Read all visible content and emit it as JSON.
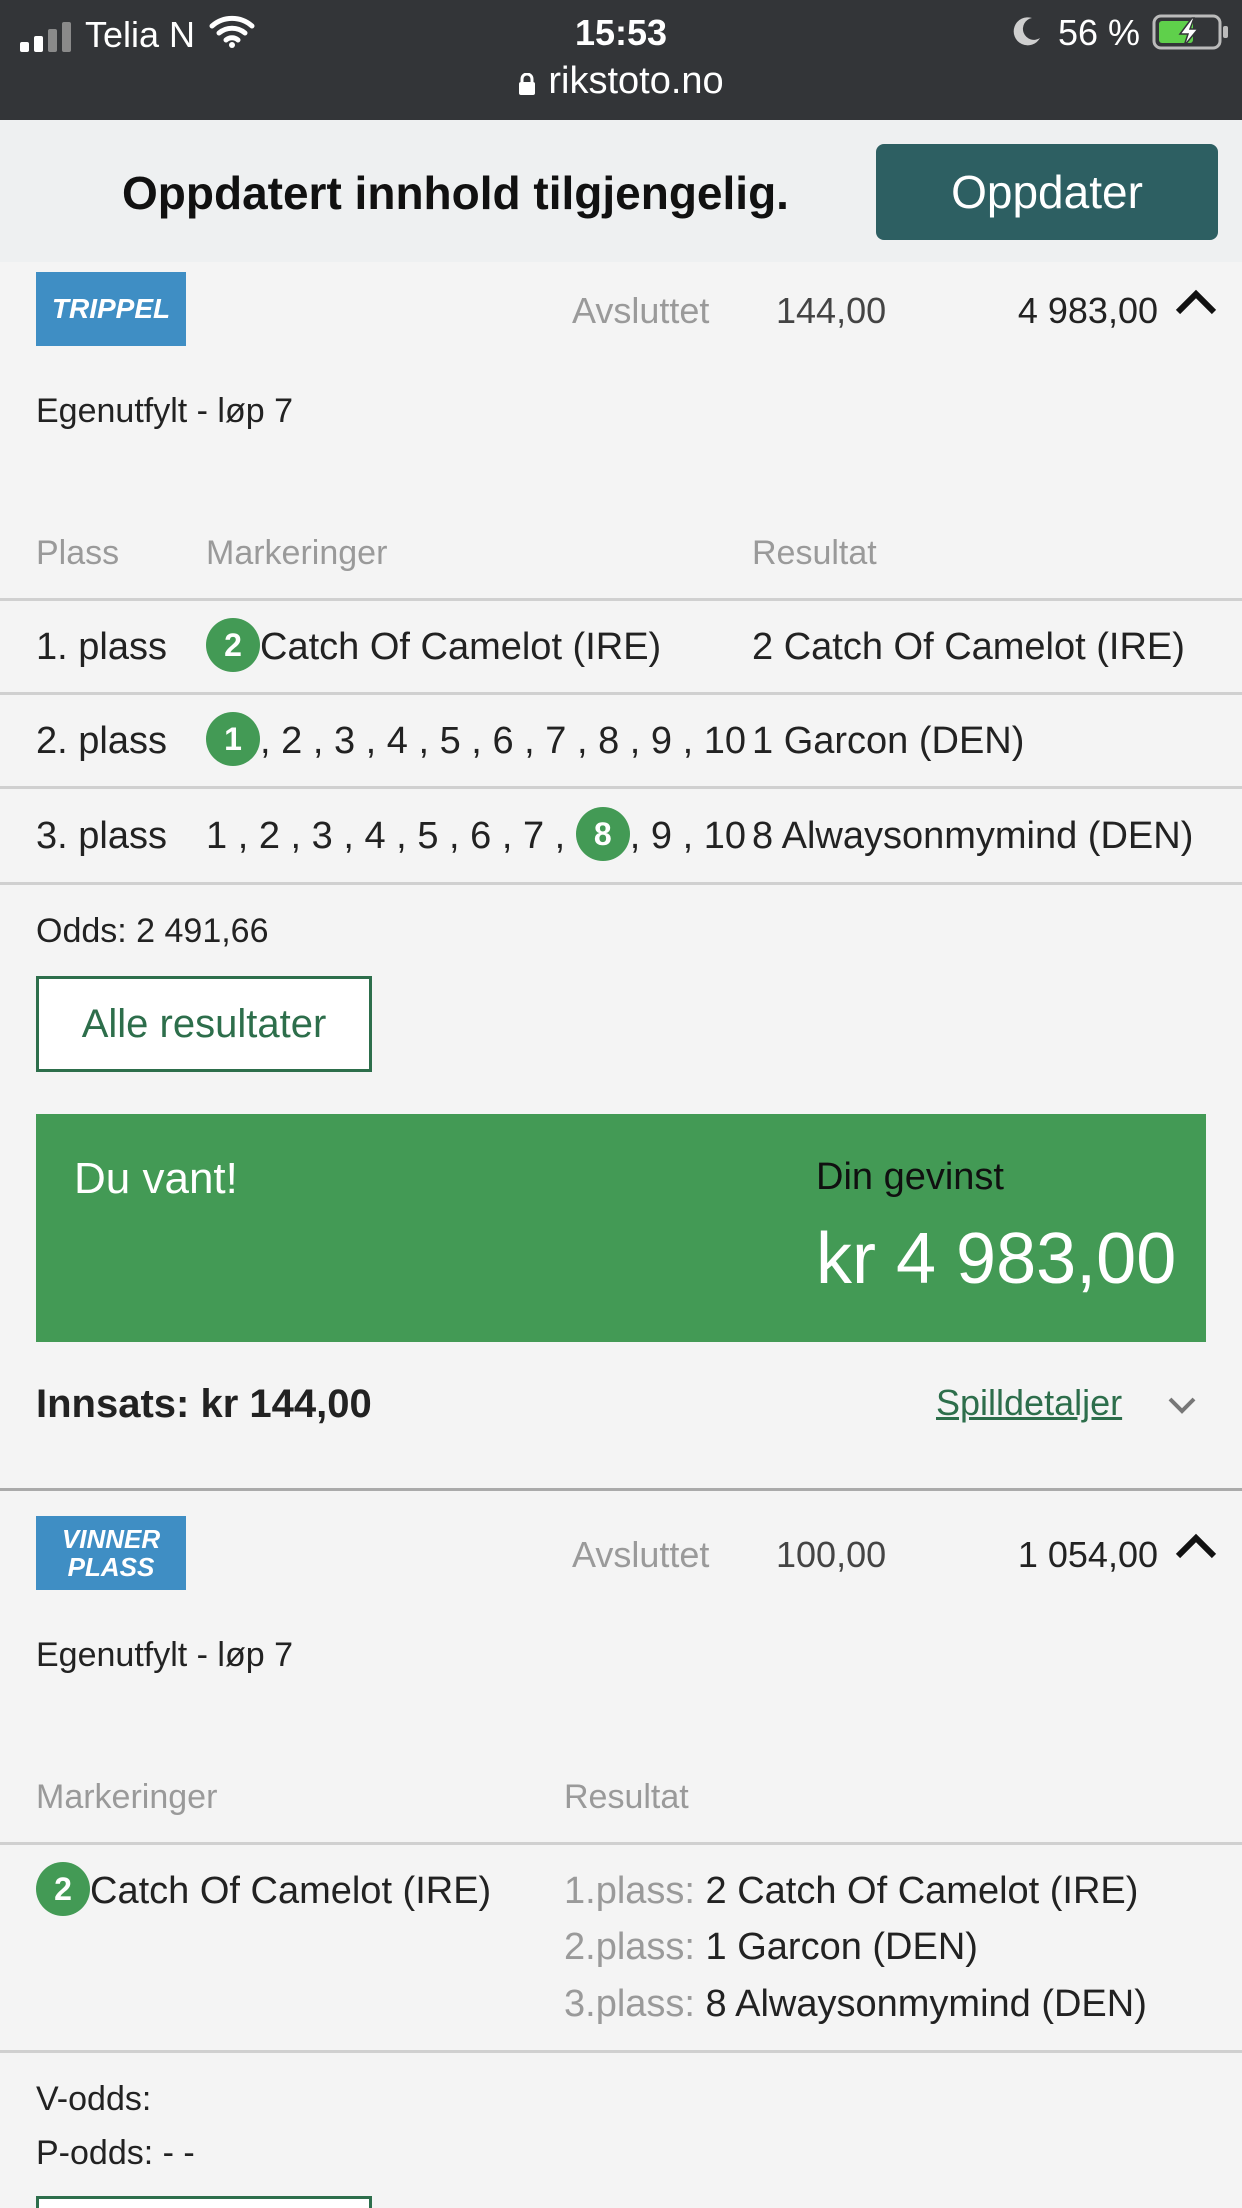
{
  "status_bar": {
    "carrier": "Telia N",
    "time": "15:53",
    "battery_text": "56 %",
    "url": "rikstoto.no",
    "icons": [
      "signal-icon",
      "wifi-icon",
      "moon-icon",
      "battery-charging-icon",
      "lock-icon"
    ]
  },
  "banner": {
    "text": "Oppdatert innhold tilgjengelig.",
    "button_label": "Oppdater"
  },
  "bets": [
    {
      "badge": "TRIPPEL",
      "status": "Avsluttet",
      "stake": "144,00",
      "winnings": "4 983,00",
      "subtitle": "Egenutfylt - løp 7",
      "columns": [
        "Plass",
        "Markeringer",
        "Resultat"
      ],
      "rows": [
        {
          "place": "1. plass",
          "marks": [
            {
              "n": "2",
              "hit": true
            }
          ],
          "mark_suffix": "Catch Of Camelot (IRE)",
          "result": "2 Catch Of Camelot (IRE)"
        },
        {
          "place": "2. plass",
          "marks": [
            {
              "n": "1",
              "hit": true
            },
            {
              "n": "2"
            },
            {
              "n": "3"
            },
            {
              "n": "4"
            },
            {
              "n": "5"
            },
            {
              "n": "6"
            },
            {
              "n": "7"
            },
            {
              "n": "8"
            },
            {
              "n": "9"
            },
            {
              "n": "10"
            }
          ],
          "result": "1 Garcon (DEN)"
        },
        {
          "place": "3. plass",
          "marks": [
            {
              "n": "1"
            },
            {
              "n": "2"
            },
            {
              "n": "3"
            },
            {
              "n": "4"
            },
            {
              "n": "5"
            },
            {
              "n": "6"
            },
            {
              "n": "7"
            },
            {
              "n": "8",
              "hit": true
            },
            {
              "n": "9"
            },
            {
              "n": "10"
            }
          ],
          "result": "8 Alwaysonmymind (DEN)"
        }
      ],
      "odds": "Odds: 2 491,66",
      "all_results_label": "Alle resultater",
      "win": {
        "title": "Du vant!",
        "label": "Din gevinst",
        "amount": "kr 4 983,00"
      },
      "stake_line": "Innsats: kr 144,00",
      "details_label": "Spilldetaljer"
    },
    {
      "badge_line1": "VINNER",
      "badge_line2": "PLASS",
      "status": "Avsluttet",
      "stake": "100,00",
      "winnings": "1 054,00",
      "subtitle": "Egenutfylt - løp 7",
      "columns": [
        "Markeringer",
        "Resultat"
      ],
      "mark": {
        "n": "2",
        "name": "Catch Of Camelot (IRE)"
      },
      "results": [
        {
          "label": "1.plass:",
          "value": "2 Catch Of Camelot (IRE)"
        },
        {
          "label": "2.plass:",
          "value": "1 Garcon (DEN)"
        },
        {
          "label": "3.plass:",
          "value": "8 Alwaysonmymind (DEN)"
        }
      ],
      "v_odds": "V-odds:",
      "p_odds": "P-odds: - -"
    }
  ],
  "colors": {
    "status_bar": "#333538",
    "banner_button": "#2d5f62",
    "win_green": "#439a55",
    "badge_blue": "#3f8ec4",
    "link_green": "#2d6e4b"
  }
}
